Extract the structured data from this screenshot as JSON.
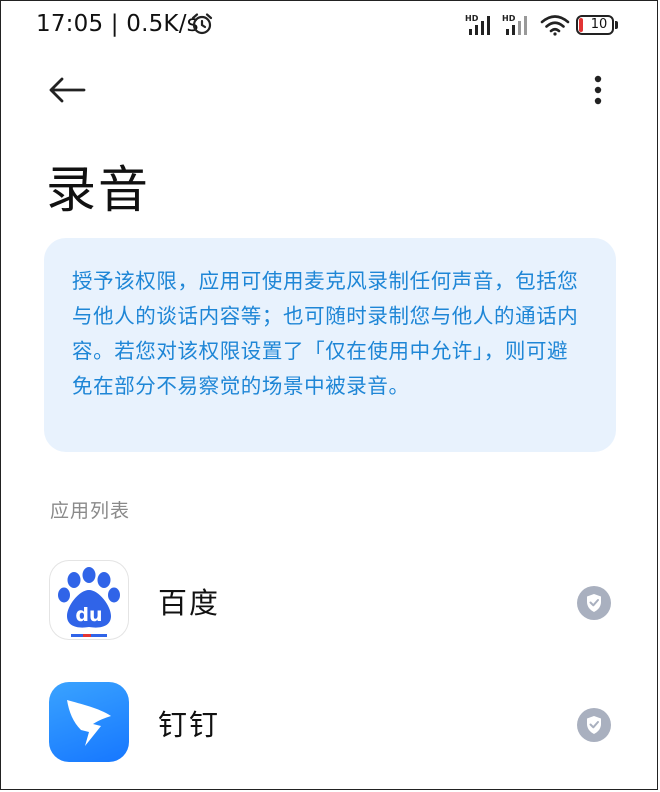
{
  "status_bar": {
    "time": "17:05 | 0.5K/s",
    "battery": "10",
    "icons": [
      "alarm-icon",
      "signal-hd-icon",
      "signal-hd-icon",
      "wifi-icon",
      "battery-icon"
    ],
    "battery_low_color": "#e23434"
  },
  "app_bar": {
    "back_icon": "arrow-left-icon",
    "more_icon": "more-vertical-icon"
  },
  "page": {
    "title": "录音",
    "description": "授予该权限，应用可使用麦克风录制任何声音，包括您与他人的谈话内容等；也可随时录制您与他人的通话内容。若您对该权限设置了「仅在使用中允许」，则可避免在部分不易察觉的场景中被录音。",
    "section_label": "应用列表"
  },
  "apps": [
    {
      "name": "百度",
      "icon": "baidu-app-icon",
      "status_icon": "shield-check-icon"
    },
    {
      "name": "钉钉",
      "icon": "dingtalk-app-icon",
      "status_icon": "shield-check-icon"
    }
  ],
  "colors": {
    "card_bg": "#e8f2fd",
    "card_text": "#1e86d6",
    "check_badge": "#a9b0bf"
  }
}
